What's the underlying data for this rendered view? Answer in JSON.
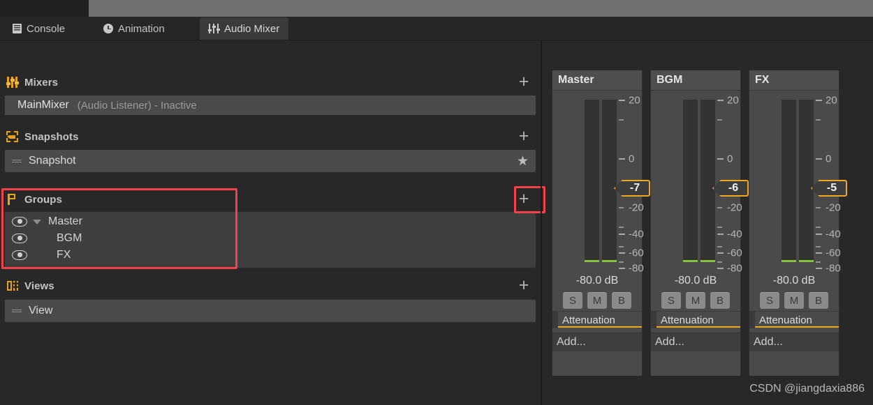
{
  "window": {
    "background_color": "#282828",
    "topbar_color": "#707070"
  },
  "tabs": [
    {
      "id": "console",
      "label": "Console",
      "icon": "console-icon",
      "active": false
    },
    {
      "id": "animation",
      "label": "Animation",
      "icon": "clock-icon",
      "active": false
    },
    {
      "id": "audio-mixer",
      "label": "Audio Mixer",
      "icon": "mixer-sliders-icon",
      "active": true
    }
  ],
  "left_panel": {
    "sections": [
      {
        "id": "mixers",
        "title": "Mixers",
        "icon": "mixer-sliders-icon",
        "add_label": "+",
        "rows": [
          {
            "name": "MainMixer",
            "subtitle": "(Audio Listener) - Inactive",
            "selected": true
          }
        ]
      },
      {
        "id": "snapshots",
        "title": "Snapshots",
        "icon": "snapshot-icon",
        "add_label": "+",
        "rows": [
          {
            "name": "Snapshot",
            "star": "★",
            "selected": false
          }
        ]
      },
      {
        "id": "groups",
        "title": "Groups",
        "icon": "groups-flag-icon",
        "add_label": "+",
        "highlighted": true,
        "rows": [
          {
            "name": "Master",
            "depth": 0,
            "expanded": true,
            "visible_icon": "eye-icon"
          },
          {
            "name": "BGM",
            "depth": 1,
            "expanded": false,
            "visible_icon": "eye-icon"
          },
          {
            "name": "FX",
            "depth": 1,
            "expanded": false,
            "visible_icon": "eye-icon"
          }
        ]
      },
      {
        "id": "views",
        "title": "Views",
        "icon": "views-icon",
        "add_label": "+",
        "rows": [
          {
            "name": "View",
            "selected": false
          }
        ]
      }
    ]
  },
  "mixer_strips": {
    "scale": {
      "labels": [
        "20",
        "0",
        "-20",
        "-40",
        "-60",
        "-80"
      ],
      "major_ticks_db": [
        20,
        0,
        -20,
        -40,
        -60,
        -80
      ],
      "minor_ticks_db": [
        10,
        -7,
        -30,
        -50,
        -70
      ],
      "range_db": [
        -80,
        20
      ]
    },
    "smb_buttons": [
      "S",
      "M",
      "B"
    ],
    "effect_label": "Attenuation",
    "add_label": "Add...",
    "strips": [
      {
        "name": "Master",
        "fader_db": "-7",
        "level_db": "-80.0 dB",
        "meter_value": -80
      },
      {
        "name": "BGM",
        "fader_db": "-6",
        "level_db": "-80.0 dB",
        "meter_value": -80
      },
      {
        "name": "FX",
        "fader_db": "-5",
        "level_db": "-80.0 dB",
        "meter_value": -80
      }
    ]
  },
  "watermark": "CSDN @jiangdaxia886",
  "accent_colors": {
    "unity_orange": "#f0a81e",
    "highlight_red": "#f4424a",
    "meter_green": "#84c33a"
  }
}
